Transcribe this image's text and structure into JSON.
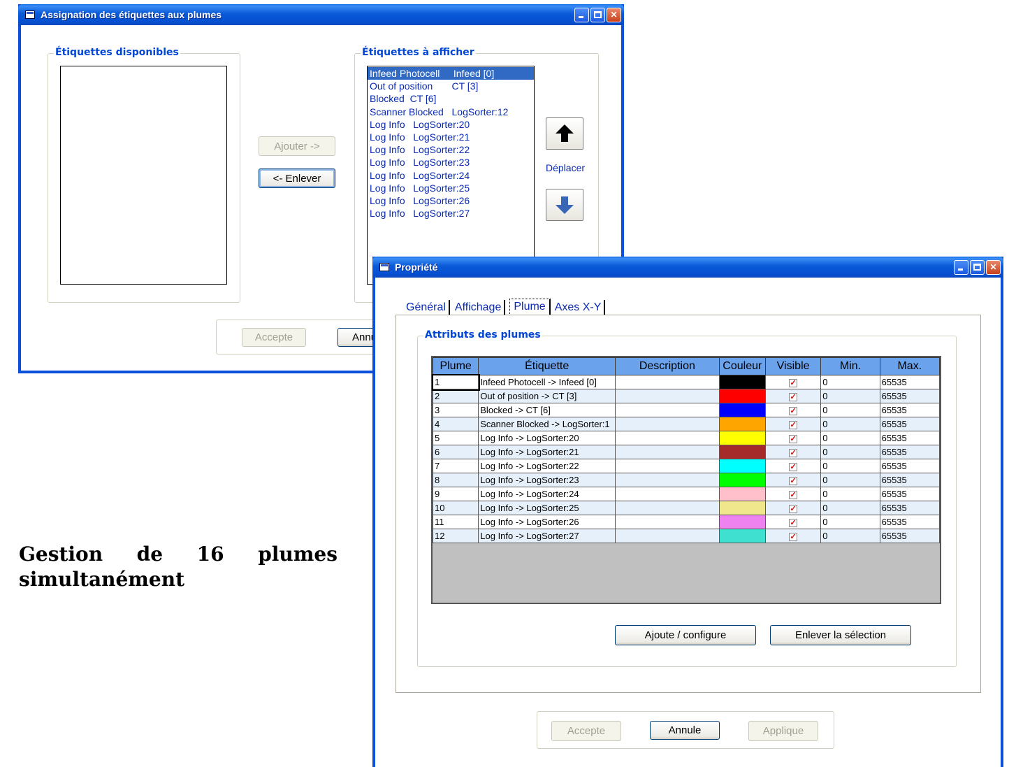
{
  "caption": {
    "line1_words": [
      "Gestion",
      "de",
      "16",
      "plumes"
    ],
    "line2": "simultanément"
  },
  "assign_window": {
    "title": "Assignation des étiquettes aux plumes",
    "available_group": {
      "label": "Étiquettes disponibles",
      "items": []
    },
    "display_group": {
      "label": "Étiquettes à afficher",
      "items": [
        "Infeed Photocell     Infeed [0]",
        "Out of position       CT [3]",
        "Blocked  CT [6]",
        "Scanner Blocked   LogSorter:12",
        "Log Info   LogSorter:20",
        "Log Info   LogSorter:21",
        "Log Info   LogSorter:22",
        "Log Info   LogSorter:23",
        "Log Info   LogSorter:24",
        "Log Info   LogSorter:25",
        "Log Info   LogSorter:26",
        "Log Info   LogSorter:27"
      ],
      "selected_index": 0
    },
    "add_button": "Ajouter  ->",
    "remove_button": "<- Enlever",
    "move_label": "Déplacer",
    "move_up_icon": "arrow-up-icon",
    "move_down_icon": "arrow-down-icon",
    "accept_button": "Accepte",
    "cancel_button_partial": "Annu"
  },
  "prop_window": {
    "title": "Propriété",
    "tabs": [
      "Général",
      "Affichage",
      "Plume",
      "Axes X-Y"
    ],
    "active_tab": "Plume",
    "group_label": "Attributs des plumes",
    "columns": [
      "Plume",
      "Étiquette",
      "Description",
      "Couleur",
      "Visible",
      "Min.",
      "Max."
    ],
    "rows": [
      {
        "plume": "1",
        "etiquette": "Infeed Photocell -> Infeed [0]",
        "description": "",
        "color": "#000000",
        "visible": true,
        "min": "0",
        "max": "65535"
      },
      {
        "plume": "2",
        "etiquette": "Out of position -> CT [3]",
        "description": "",
        "color": "#ff0000",
        "visible": true,
        "min": "0",
        "max": "65535"
      },
      {
        "plume": "3",
        "etiquette": "Blocked -> CT [6]",
        "description": "",
        "color": "#0000ff",
        "visible": true,
        "min": "0",
        "max": "65535"
      },
      {
        "plume": "4",
        "etiquette": "Scanner Blocked -> LogSorter:1",
        "description": "",
        "color": "#ffa500",
        "visible": true,
        "min": "0",
        "max": "65535"
      },
      {
        "plume": "5",
        "etiquette": "Log Info -> LogSorter:20",
        "description": "",
        "color": "#ffff00",
        "visible": true,
        "min": "0",
        "max": "65535"
      },
      {
        "plume": "6",
        "etiquette": "Log Info -> LogSorter:21",
        "description": "",
        "color": "#a52a2a",
        "visible": true,
        "min": "0",
        "max": "65535"
      },
      {
        "plume": "7",
        "etiquette": "Log Info -> LogSorter:22",
        "description": "",
        "color": "#00ffff",
        "visible": true,
        "min": "0",
        "max": "65535"
      },
      {
        "plume": "8",
        "etiquette": "Log Info -> LogSorter:23",
        "description": "",
        "color": "#00ff00",
        "visible": true,
        "min": "0",
        "max": "65535"
      },
      {
        "plume": "9",
        "etiquette": "Log Info -> LogSorter:24",
        "description": "",
        "color": "#ffc0cb",
        "visible": true,
        "min": "0",
        "max": "65535"
      },
      {
        "plume": "10",
        "etiquette": "Log Info -> LogSorter:25",
        "description": "",
        "color": "#f0e68c",
        "visible": true,
        "min": "0",
        "max": "65535"
      },
      {
        "plume": "11",
        "etiquette": "Log Info -> LogSorter:26",
        "description": "",
        "color": "#ee82ee",
        "visible": true,
        "min": "0",
        "max": "65535"
      },
      {
        "plume": "12",
        "etiquette": "Log Info -> LogSorter:27",
        "description": "",
        "color": "#40e0d0",
        "visible": true,
        "min": "0",
        "max": "65535"
      }
    ],
    "add_config_button": "Ajoute / configure",
    "remove_selection_button": "Enlever la sélection",
    "accept_button": "Accepte",
    "cancel_button": "Annule",
    "apply_button": "Applique"
  }
}
